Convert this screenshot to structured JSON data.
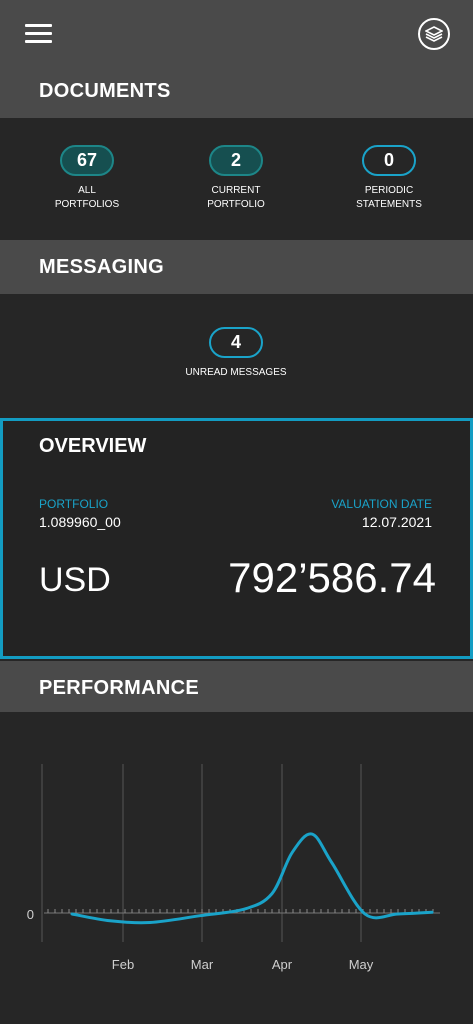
{
  "header": {
    "menu_icon": "hamburger-menu-icon",
    "logo_icon": "layers-logo-icon"
  },
  "documents": {
    "title": "DOCUMENTS",
    "stats": [
      {
        "value": "67",
        "label_line1": "ALL",
        "label_line2": "PORTFOLIOS"
      },
      {
        "value": "2",
        "label_line1": "CURRENT",
        "label_line2": "PORTFOLIO"
      },
      {
        "value": "0",
        "label_line1": "PERIODIC",
        "label_line2": "STATEMENTS"
      }
    ]
  },
  "messaging": {
    "title": "MESSAGING",
    "unread_value": "4",
    "unread_label": "UNREAD MESSAGES"
  },
  "overview": {
    "title": "OVERVIEW",
    "portfolio_label": "PORTFOLIO",
    "portfolio_value": "1.089960_00",
    "valuation_label": "VALUATION DATE",
    "valuation_value": "12.07.2021",
    "currency": "USD",
    "amount": "792’586.74"
  },
  "performance": {
    "title": "PERFORMANCE"
  },
  "colors": {
    "accent": "#1aa3c9",
    "header_bg": "#4a4a4a",
    "panel_bg": "#262626"
  },
  "chart_data": {
    "type": "line",
    "x_ticks": [
      "Feb",
      "Mar",
      "Apr",
      "May"
    ],
    "y_ticks": [
      "0"
    ],
    "x": [
      "Jan 20",
      "Feb 1",
      "Feb 15",
      "Mar 1",
      "Mar 15",
      "Apr 1",
      "Apr 8",
      "Apr 15",
      "Apr 22",
      "May 1",
      "May 15",
      "Jun 1"
    ],
    "series": [
      {
        "values": [
          0.0,
          -0.4,
          -0.5,
          -0.1,
          0.3,
          1.2,
          3.6,
          4.7,
          3.0,
          0.0,
          0.0,
          0.1
        ]
      }
    ],
    "ylim": [
      -1.5,
      8
    ],
    "grid": "vertical"
  }
}
